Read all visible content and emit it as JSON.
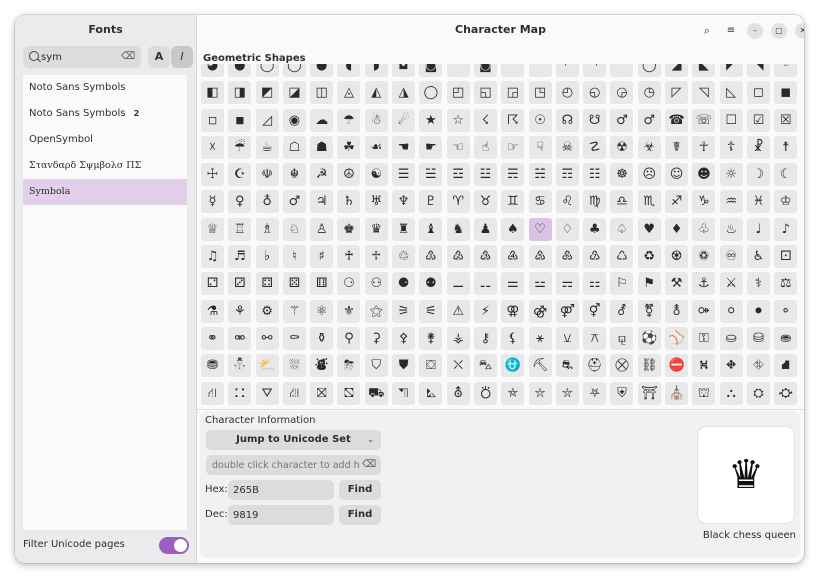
{
  "sidebar": {
    "title": "Fonts",
    "search": {
      "value": "sym",
      "placeholder": ""
    },
    "style_buttons": {
      "bold": "A",
      "italic": "I"
    },
    "fonts": [
      {
        "label": "Noto Sans Symbols",
        "badge": ""
      },
      {
        "label": "Noto Sans Symbols",
        "badge": "2"
      },
      {
        "label": "OpenSymbol",
        "badge": ""
      },
      {
        "label": "Σταvδαρδ Σψμβoλσ ΠΣ",
        "badge": ""
      },
      {
        "label": "Symbola",
        "badge": "",
        "selected": true
      }
    ],
    "filter_label": "Filter Unicode pages",
    "filter_enabled": true
  },
  "header": {
    "title": "Character Map",
    "icons": [
      "search-icon",
      "menu-icon",
      "minimize-icon",
      "maximize-icon",
      "close-icon"
    ]
  },
  "section_title": "Geometric Shapes",
  "grid": {
    "cells": [
      "◕",
      "●",
      "◯",
      "◯",
      "●",
      "◖",
      "◗",
      "◘",
      "◙",
      "",
      "◙",
      "",
      "",
      "◜",
      "◝",
      "",
      "◯",
      "◢",
      "◣",
      "◤",
      "◥",
      "◦",
      "◧",
      "◨",
      "◩",
      "◪",
      "◫",
      "◬",
      "◭",
      "◮",
      "◯",
      "◰",
      "◱",
      "◲",
      "◳",
      "◴",
      "◵",
      "◶",
      "◷",
      "◸",
      "◹",
      "◺",
      "◻",
      "◼",
      "◽",
      "◾",
      "◿",
      "◉",
      "☁",
      "☂",
      "☃",
      "☄",
      "★",
      "☆",
      "☇",
      "☈",
      "☉",
      "☊",
      "☋",
      "♂",
      "♂",
      "☎",
      "☏",
      "☐",
      "☑",
      "☒",
      "☓",
      "☔",
      "☕",
      "☖",
      "☗",
      "☘",
      "☙",
      "☚",
      "☛",
      "☜",
      "☝",
      "☞",
      "☟",
      "☠",
      "☡",
      "☢",
      "☣",
      "☤",
      "☥",
      "☦",
      "☧",
      "☨",
      "☩",
      "☪",
      "☫",
      "☬",
      "☭",
      "☮",
      "☯",
      "☰",
      "☱",
      "☲",
      "☳",
      "☴",
      "☵",
      "☶",
      "☷",
      "☸",
      "☹",
      "☺",
      "☻",
      "☼",
      "☽",
      "☾",
      "☿",
      "♀",
      "♁",
      "♂",
      "♃",
      "♄",
      "♅",
      "♆",
      "♇",
      "♈",
      "♉",
      "♊",
      "♋",
      "♌",
      "♍",
      "♎",
      "♏",
      "♐",
      "♑",
      "♒",
      "♓",
      "♔",
      "♕",
      "♖",
      "♗",
      "♘",
      "♙",
      "♚",
      "♛",
      "♜",
      "♝",
      "♞",
      "♟",
      "♠",
      "♡",
      "♢",
      "♣",
      "♤",
      "♥",
      "♦",
      "♧",
      "♨",
      "♩",
      "♪",
      "♫",
      "♬",
      "♭",
      "♮",
      "♯",
      "♰",
      "♱",
      "♲",
      "♳",
      "♴",
      "♵",
      "♶",
      "♷",
      "♸",
      "♹",
      "♺",
      "♻",
      "♼",
      "♽",
      "♾",
      "♿",
      "⚀",
      "⚁",
      "⚂",
      "⚃",
      "⚄",
      "⚅",
      "⚆",
      "⚇",
      "⚈",
      "⚉",
      "⚊",
      "⚋",
      "⚌",
      "⚍",
      "⚎",
      "⚏",
      "⚐",
      "⚑",
      "⚒",
      "⚓",
      "⚔",
      "⚕",
      "⚖",
      "⚗",
      "⚘",
      "⚙",
      "⚚",
      "⚛",
      "⚜",
      "⚝",
      "⚞",
      "⚟",
      "⚠",
      "⚡",
      "⚢",
      "⚣",
      "⚤",
      "⚥",
      "⚦",
      "⚧",
      "⚨",
      "⚩",
      "⚪",
      "⚫",
      "⚬",
      "⚭",
      "⚮",
      "⚯",
      "⚰",
      "⚱",
      "⚲",
      "⚳",
      "⚴",
      "⚵",
      "⚶",
      "⚷",
      "⚸",
      "⚹",
      "⚺",
      "⚻",
      "⚼",
      "⚽",
      "⚾",
      "⚿",
      "⛀",
      "⛁",
      "⛂",
      "⛃",
      "⛄",
      "⛅",
      "⛆",
      "⛇",
      "⛈",
      "⛉",
      "⛊",
      "⛋",
      "⛌",
      "⛍",
      "⛎",
      "⛏",
      "⛐",
      "⛑",
      "⛒",
      "⛓",
      "⛔",
      "⛕",
      "⛖",
      "⛗",
      "⛘",
      "⛙",
      "⛚",
      "⛛",
      "⛜",
      "⛝",
      "⛞",
      "⛟",
      "⛠",
      "⛡",
      "⛢",
      "⛣",
      "⛤",
      "⛥",
      "⛦",
      "⛧",
      "⛨",
      "⛩",
      "⛪",
      "⛫",
      "⛬",
      "⛭",
      "⛮",
      "⛯",
      "⛰",
      "⛱",
      "⛲",
      "⛳",
      "⛴",
      "⛵",
      "⛶",
      "⛷",
      "⛸",
      "⛹",
      "⛺",
      "⛻",
      "⛼",
      "⛽",
      "⛾",
      "⛿",
      "✀",
      "✁",
      "✂",
      "✃",
      "✄"
    ],
    "selected_index": 144
  },
  "info": {
    "title": "Character Information",
    "jump_label": "Jump to Unicode Set",
    "add_placeholder": "double click character to add he…",
    "hex_label": "Hex:",
    "hex_value": "265B",
    "dec_label": "Dec:",
    "dec_value": "9819",
    "find_label": "Find",
    "preview_char": "♛",
    "char_name": "Black chess queen"
  },
  "colors": {
    "accent": "#9b5fc1",
    "selection": "#e4cfe9",
    "cell_selected": "#d9c2e3"
  }
}
